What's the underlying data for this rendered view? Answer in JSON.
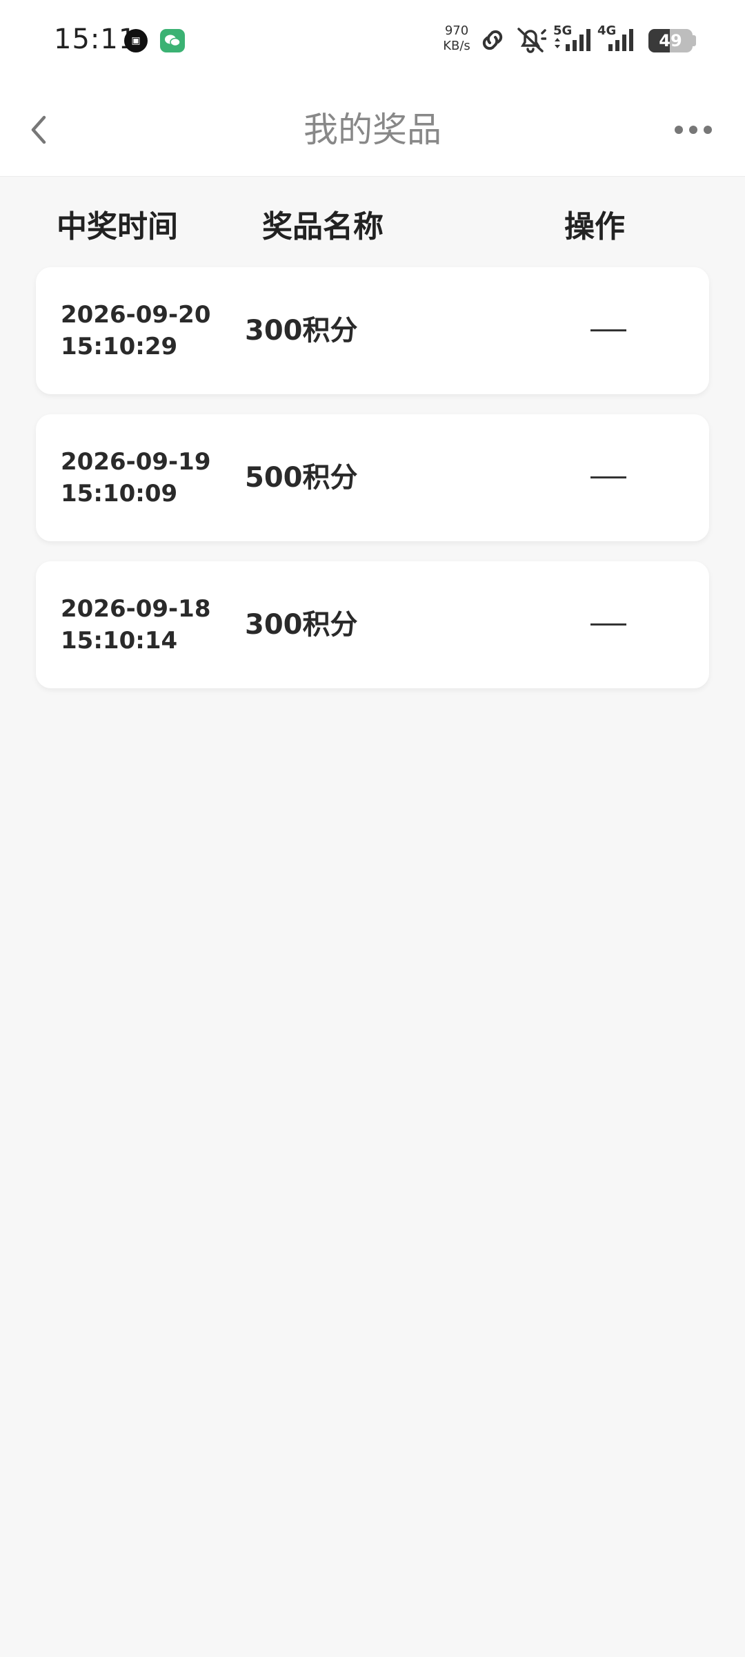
{
  "status_bar": {
    "time": "15:11",
    "net_speed_value": "970",
    "net_speed_unit": "KB/s",
    "signal_1_label": "5G",
    "signal_2_label": "4G",
    "battery": "49"
  },
  "header": {
    "title": "我的奖品"
  },
  "table": {
    "columns": [
      "中奖时间",
      "奖品名称",
      "操作"
    ],
    "rows": [
      {
        "date": "2026-09-20",
        "time": "15:10:29",
        "prize": "300积分",
        "action": "—"
      },
      {
        "date": "2026-09-19",
        "time": "15:10:09",
        "prize": "500积分",
        "action": "—"
      },
      {
        "date": "2026-09-18",
        "time": "15:10:14",
        "prize": "300积分",
        "action": "—"
      }
    ]
  }
}
